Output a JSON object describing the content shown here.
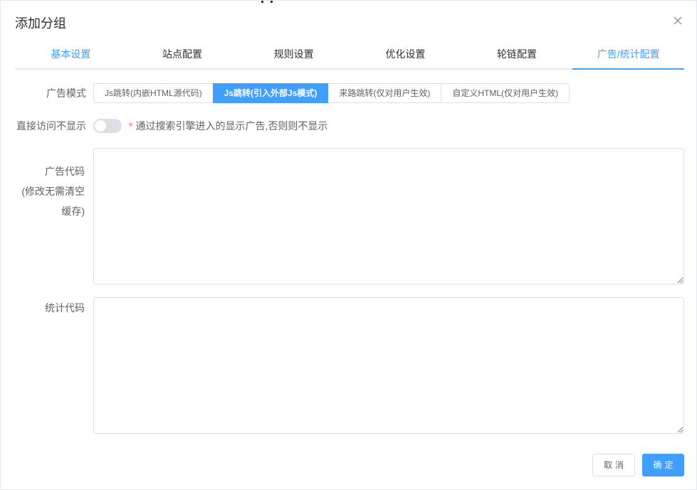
{
  "dialog": {
    "title": "添加分组",
    "close_icon": "close-icon"
  },
  "tabs": [
    {
      "label": "基本设置",
      "state": "link"
    },
    {
      "label": "站点配置",
      "state": "normal"
    },
    {
      "label": "规则设置",
      "state": "normal"
    },
    {
      "label": "优化设置",
      "state": "normal"
    },
    {
      "label": "轮链配置",
      "state": "normal"
    },
    {
      "label": "广告/统计配置",
      "state": "selected"
    }
  ],
  "form": {
    "ad_mode": {
      "label": "广告模式",
      "options": [
        "Js跳转(内嵌HTML源代码)",
        "Js跳转(引入外部Js模式)",
        "来路跳转(仅对用户生效)",
        "自定义HTML(仅对用户生效)"
      ],
      "selected_index": 1
    },
    "direct_access": {
      "label": "直接访问不显示",
      "switch_on": false,
      "hint_star": "*",
      "hint": "通过搜索引擎进入的显示广告,否则则不显示"
    },
    "ad_code": {
      "label_line1": "广告代码",
      "label_line2": "(修改无需清空",
      "label_line3": "缓存)",
      "value": ""
    },
    "stat_code": {
      "label": "统计代码",
      "value": ""
    }
  },
  "footer": {
    "cancel_label": "取消",
    "ok_label": "确定"
  },
  "colors": {
    "accent": "#409eff",
    "border": "#dcdfe6",
    "text": "#606266",
    "title": "#303133",
    "required": "#f56c6c"
  }
}
